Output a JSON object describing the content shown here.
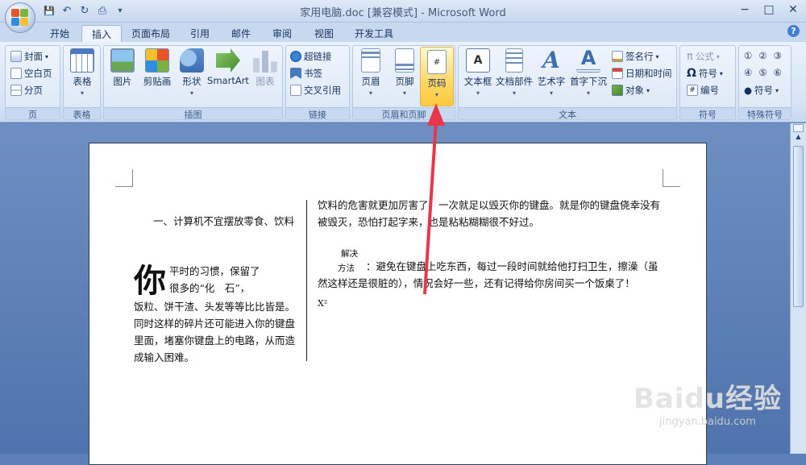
{
  "window": {
    "title": "家用电脑.doc [兼容模式] - Microsoft Word",
    "controls": {
      "minimize": "−",
      "restore": "□",
      "close": "✕"
    }
  },
  "qat": {
    "save": "💾",
    "undo": "↶",
    "redo": "↻",
    "print": "⎙",
    "customize": "▾"
  },
  "tabs": [
    "开始",
    "插入",
    "页面布局",
    "引用",
    "邮件",
    "审阅",
    "视图",
    "开发工具"
  ],
  "active_tab": "插入",
  "help": "?",
  "ribbon": {
    "pages": {
      "cover": "封面",
      "blank": "空白页",
      "break": "分页",
      "label": "页"
    },
    "tables": {
      "table": "表格",
      "label": "表格"
    },
    "illustrations": {
      "picture": "图片",
      "clipart": "剪贴画",
      "shapes": "形状",
      "smartart": "SmartArt",
      "chart": "图表",
      "label": "插图"
    },
    "links": {
      "hyperlink": "超链接",
      "bookmark": "书签",
      "crossref": "交叉引用",
      "label": "链接"
    },
    "header_footer": {
      "header": "页眉",
      "footer": "页脚",
      "page_number": "页码",
      "label": "页眉和页脚"
    },
    "text": {
      "textbox": "文本框",
      "quickparts": "文档部件",
      "wordart": "艺术字",
      "dropcap": "首字下沉",
      "signature": "签名行",
      "datetime": "日期和时间",
      "object": "对象",
      "label": "文本"
    },
    "symbols": {
      "equation": "公式",
      "symbol": "符号",
      "number": "编号",
      "label": "符号"
    },
    "special": {
      "row1": [
        "①",
        "②",
        "③"
      ],
      "row2": [
        "④",
        "⑤",
        "⑥"
      ],
      "more": "符号",
      "label": "特殊符号"
    }
  },
  "document": {
    "left_col_heading": "一、计算机不宜摆放零食、饮料",
    "dropcap": "你",
    "left_col_body_1": "平时的习惯，保留了",
    "left_col_body_2": "很多的“化　石”，",
    "left_col_body_3": "饭粒、饼干渣、头发等等比比皆是。同时这样的碎片还可能进入你的键盘里面，堵塞你键盘上的电路，从而造成输入困难。",
    "right_col_para": "饮料的危害就更加厉害了，一次就足以毁灭你的键盘。就是你的键盘侥幸没有被毁灭，恐怕打起字来，也是粘粘糊糊很不好过。",
    "solution_label_1": "解决",
    "solution_label_2": "方法",
    "solution_text": "：避免在键盘上吃东西，每过一段时间就给他打扫卫生，擦澡（虽然这样还是很脏的），情况会好一些，还有记得给你房间买一个饭桌了！",
    "superscript": "X²"
  },
  "watermark": {
    "brand": "Baidu经验",
    "url": "jingyan.baidu.com"
  },
  "colors": {
    "ribbon_bg": "#dbe7f6",
    "highlight": "#ffd766",
    "arrow": "#e8374a"
  }
}
